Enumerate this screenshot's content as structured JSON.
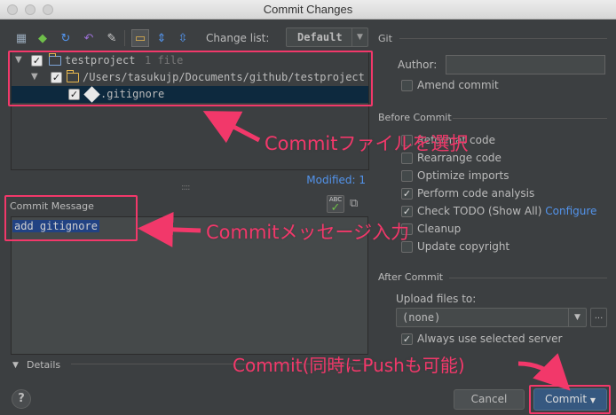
{
  "window": {
    "title": "Commit Changes"
  },
  "toolbar": {
    "change_list_label": "Change list:",
    "change_list_value": "Default"
  },
  "tree": {
    "root": {
      "label": "testproject",
      "hint": "1 file"
    },
    "folder": {
      "label": "/Users/tasukujp/Documents/github/testproject"
    },
    "file": {
      "label": ".gitignore"
    }
  },
  "status": {
    "modified": "Modified: 1"
  },
  "commit_message": {
    "label": "Commit Message",
    "text": "add gitignore",
    "spell_icon_text": "ABC"
  },
  "details": {
    "label": "Details",
    "dots": "::::"
  },
  "git_panel": {
    "git_section": "Git",
    "author_label": "Author:",
    "author_value": "",
    "amend_label": "Amend commit",
    "before_section": "Before Commit",
    "before_options": [
      {
        "label": "Reformat code",
        "checked": false
      },
      {
        "label": "Rearrange code",
        "checked": false
      },
      {
        "label": "Optimize imports",
        "checked": false
      },
      {
        "label": "Perform code analysis",
        "checked": true
      },
      {
        "label": "Check TODO (Show All)",
        "checked": true
      },
      {
        "label": "Cleanup",
        "checked": false
      },
      {
        "label": "Update copyright",
        "checked": false
      }
    ],
    "configure_link": "Configure",
    "after_section": "After Commit",
    "upload_label": "Upload files to:",
    "upload_value": "(none)",
    "upload_more": "...",
    "always_use_label": "Always use selected server"
  },
  "buttons": {
    "help": "?",
    "cancel": "Cancel",
    "commit": "Commit"
  },
  "annotations": {
    "select_file": "Commitファイルを選択",
    "enter_message": "Commitメッセージ入力",
    "commit_push": "Commit(同時にPushも可能)",
    "color": "#f2386a"
  }
}
